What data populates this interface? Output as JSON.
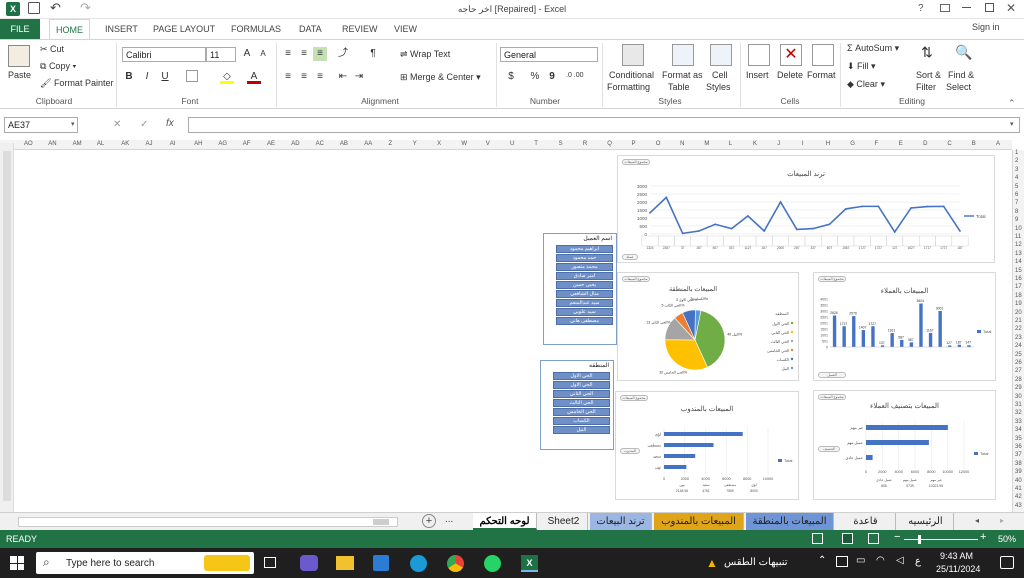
{
  "titlebar": {
    "title": "اخر حاجه  [Repaired] - Excel",
    "help": "?",
    "signin": "Sign in"
  },
  "ribbon_tabs": [
    "FILE",
    "HOME",
    "INSERT",
    "PAGE LAYOUT",
    "FORMULAS",
    "DATA",
    "REVIEW",
    "VIEW"
  ],
  "clipboard": {
    "paste": "Paste",
    "cut": "Cut",
    "copy": "Copy",
    "format_painter": "Format Painter",
    "label": "Clipboard"
  },
  "font": {
    "name": "Calibri",
    "size": "11",
    "grow": "A",
    "shrink": "A",
    "bold": "B",
    "italic": "I",
    "underline": "U",
    "color_letter": "A",
    "label": "Font"
  },
  "alignment": {
    "wrap": "Wrap Text",
    "merge": "Merge & Center",
    "label": "Alignment"
  },
  "number": {
    "format": "General",
    "currency": "$",
    "percent": "%",
    "comma": "9",
    "inc_dec": ".0 .00",
    "label": "Number"
  },
  "styles": {
    "conditional": "Conditional",
    "conditional2": "Formatting",
    "format_table": "Format as",
    "format_table2": "Table",
    "cell_styles": "Cell",
    "cell_styles2": "Styles",
    "label": "Styles"
  },
  "cells": {
    "insert": "Insert",
    "delete": "Delete",
    "format": "Format",
    "label": "Cells"
  },
  "editing": {
    "autosum": "AutoSum",
    "fill": "Fill",
    "clear": "Clear",
    "sort": "Sort &",
    "sort2": "Filter",
    "find": "Find &",
    "find2": "Select",
    "label": "Editing"
  },
  "formula_bar": {
    "name_box": "AE37",
    "fx": "fx",
    "x": "✕",
    "check": "✓",
    "value": ""
  },
  "columns": [
    "AO",
    "AN",
    "AM",
    "AL",
    "AK",
    "AJ",
    "AI",
    "AH",
    "AG",
    "AF",
    "AE",
    "AD",
    "AC",
    "AB",
    "AA",
    "Z",
    "Y",
    "X",
    "W",
    "V",
    "U",
    "T",
    "S",
    "R",
    "Q",
    "P",
    "O",
    "N",
    "M",
    "L",
    "K",
    "J",
    "I",
    "H",
    "G",
    "F",
    "E",
    "D",
    "C",
    "B",
    "A"
  ],
  "rows": [
    "1",
    "2",
    "3",
    "4",
    "5",
    "6",
    "7",
    "8",
    "9",
    "10",
    "11",
    "12",
    "13",
    "14",
    "15",
    "16",
    "17",
    "18",
    "19",
    "20",
    "21",
    "22",
    "23",
    "24",
    "25",
    "26",
    "27",
    "28",
    "29",
    "30",
    "31",
    "32",
    "33",
    "34",
    "35",
    "36",
    "37",
    "38",
    "39",
    "40",
    "41",
    "42",
    "43"
  ],
  "slicer1": {
    "title": "اسم العميل",
    "items": [
      "ابراهيم محمود",
      "حمد محمود",
      "محمد منصور",
      "امير صادق",
      "يحيى حسن",
      "منال الشافعي",
      "سيد عبدالمنعم",
      "سيد علوبي",
      "مصطفى هاني"
    ]
  },
  "slicer2": {
    "title": "المنطقه",
    "items": [
      "الحي الاول",
      "الحي الاول",
      "الحي الثاني",
      "الحي الثالث",
      "الحي الخامس",
      "الكساب",
      "النيل"
    ]
  },
  "line_panel": {
    "pill": "مجموع المبيعات",
    "pill2": "عملة"
  },
  "pie_panel": {
    "pill": "مجموع المبيعات",
    "pill2": "المنطقه"
  },
  "bar1_panel": {
    "pill": "مجموع المبيعات",
    "pill2": "العميل"
  },
  "bar2_panel": {
    "pill": "مجموع المبيعات",
    "pill2": "المندوب"
  },
  "bar3_panel": {
    "pill": "مجموع المبيعات",
    "pill2": "التصنيف"
  },
  "chart_data": [
    {
      "type": "line",
      "title": "ترند المبيعات",
      "legend": "Total",
      "ylim": [
        0,
        3000
      ],
      "ticks": [
        "0",
        "500",
        "1000",
        "1500",
        "2000",
        "2500",
        "3000"
      ],
      "values": [
        1324,
        2287,
        37,
        187,
        607,
        337,
        1127,
        187,
        2000,
        287,
        337,
        607,
        1567,
        1727,
        1727,
        127,
        1627,
        1717,
        1727,
        187
      ]
    },
    {
      "type": "pie",
      "title": "المبيعات بالمنطقة",
      "slices": [
        {
          "name": "النيل",
          "value": 40,
          "label": "النيل\n40%"
        },
        {
          "name": "الحي الخامس",
          "value": 32,
          "label": "الحي الخامس\n32%"
        },
        {
          "name": "الحي الثاني",
          "value": 13,
          "label": "الحي الثاني\n13%"
        },
        {
          "name": "الحي الثالث",
          "value": 5,
          "label": "الحي الثالث\n5%"
        },
        {
          "name": "الحي الاول",
          "value": 7,
          "label": "الحي الاول\n3%"
        },
        {
          "name": "الكساب",
          "value": 3,
          "label": "الكساب\n3%"
        }
      ],
      "legend": [
        "الحي الاول",
        "الحي الثاني",
        "الحي الثالث",
        "الحي الخامس",
        "الكساب",
        "النيل"
      ],
      "legend_title": "المنطقه"
    },
    {
      "type": "bar",
      "title": "المبيعات بالعملاء",
      "legend": "Total",
      "values": [
        2626,
        1727,
        2576,
        1407,
        1727,
        137,
        1161,
        587,
        387,
        3624,
        1167,
        3001,
        127,
        187,
        147
      ],
      "labels": [
        "2626",
        "1727",
        "2576",
        "1407",
        "1727",
        "137",
        "1161",
        "587",
        "387",
        "3624",
        "1167",
        "3001",
        "127",
        "187",
        "147"
      ],
      "ticks": [
        "0",
        "501",
        "1001",
        "1501",
        "2001",
        "2501",
        "3001",
        "3501",
        "4001"
      ]
    },
    {
      "type": "bar",
      "orientation": "horizontal",
      "title": "المبيعات بالمندوب",
      "legend": "Total",
      "categories": [
        "لؤي",
        "مصطفى",
        "سعيد",
        "نهي"
      ],
      "values": [
        7569,
        4761,
        3000,
        2148.96
      ],
      "ticks": [
        "0",
        "2000",
        "4000",
        "6000",
        "8000",
        "10000"
      ],
      "table": {
        "header": [
          "نهي",
          "سعيد",
          "مصطفى",
          "لؤي"
        ],
        "values": [
          "2148.96",
          "4761",
          "7569",
          "8000"
        ]
      }
    },
    {
      "type": "bar",
      "orientation": "horizontal",
      "title": "المبيعات بتصنيف العملاء",
      "legend": "Total",
      "categories": [
        "غير مهم",
        "عميل مهم",
        "عميل عادي"
      ],
      "values": [
        10021,
        7700,
        808
      ],
      "ticks": [
        "0",
        "2000",
        "4000",
        "6000",
        "8000",
        "10000",
        "12000"
      ],
      "table": {
        "header": [
          "عميل عادي",
          "عميل مهم",
          "غير مهم"
        ],
        "values": [
          "808",
          "9739",
          "10021.95"
        ]
      }
    }
  ],
  "sheet_tabs": [
    "الرئيسيه",
    "قاعدة البيانات",
    "المبيعات بالمنطقة",
    "المبيعات بالمندوب",
    "ترند البيعات",
    "Sheet2",
    "لوحه التحكم"
  ],
  "statusbar": {
    "ready": "READY",
    "zoom": "50%"
  },
  "taskbar": {
    "search": "Type here to search",
    "weather": "تنبيهات الطقس",
    "lang": "ع",
    "time": "9:43 AM",
    "date": "25/11/2024"
  }
}
